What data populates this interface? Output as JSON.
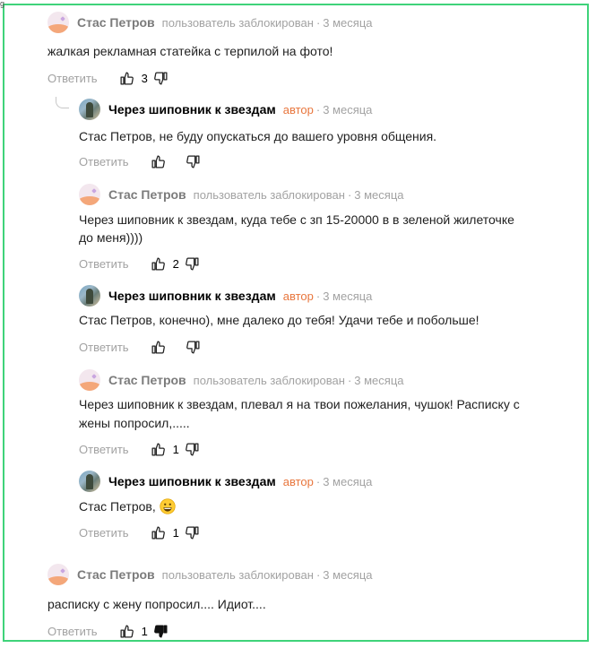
{
  "labels": {
    "reply": "Ответить",
    "blocked": "пользователь заблокирован",
    "author_badge": "автор",
    "dot": "·"
  },
  "users": {
    "stas": "Стас Петров",
    "author": "Через шиповник к звездам"
  },
  "comments": [
    {
      "user": "Стас Петров",
      "kind": "stas",
      "time": "3 месяца",
      "lines": [
        "жалкая рекламная статейка с терпилой на фото!"
      ],
      "likes": "3",
      "disliked": false
    },
    {
      "user": "Через шиповник к звездам",
      "kind": "author",
      "time": "3 месяца",
      "lines": [
        "Стас Петров, не буду опускаться до вашего уровня общения."
      ],
      "likes": "",
      "disliked": false
    },
    {
      "user": "Стас Петров",
      "kind": "stas",
      "time": "3 месяца",
      "lines": [
        "Через шиповник к звездам, куда тебе с зп 15-20000 в в зеленой жилеточке",
        "до меня))))"
      ],
      "likes": "2",
      "disliked": false
    },
    {
      "user": "Через шиповник к звездам",
      "kind": "author",
      "time": "3 месяца",
      "lines": [
        "Стас Петров, конечно), мне далеко до тебя! Удачи тебе и побольше!"
      ],
      "likes": "",
      "disliked": false
    },
    {
      "user": "Стас Петров",
      "kind": "stas",
      "time": "3 месяца",
      "lines": [
        "Через шиповник к звездам, плевал я на твои пожелания, чушок! Расписку с",
        "жены попросил,....."
      ],
      "likes": "1",
      "disliked": false
    },
    {
      "user": "Через шиповник к звездам",
      "kind": "author",
      "time": "3 месяца",
      "lines": [
        "Стас Петров,"
      ],
      "emoji": "grinning-face",
      "likes": "1",
      "disliked": false
    },
    {
      "user": "Стас Петров",
      "kind": "stas",
      "time": "3 месяца",
      "lines": [
        "расписку с жену попросил.... Идиот...."
      ],
      "likes": "1",
      "disliked": true
    }
  ],
  "colors": {
    "frame_border": "#3fd37a",
    "author_badge": "#e8763d",
    "meta_text": "#a2a2a2"
  },
  "corner_mark": "g"
}
